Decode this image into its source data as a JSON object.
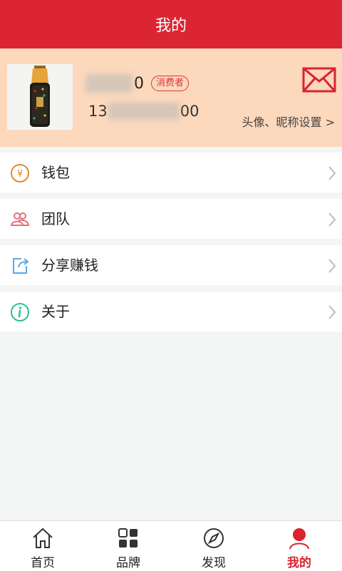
{
  "header": {
    "title": "我的"
  },
  "profile": {
    "avatar_icon": "product-bottle-avatar",
    "name_suffix": "0",
    "role_badge": "消费者",
    "phone_prefix": "13",
    "phone_suffix": "00",
    "settings_label": "头像、昵称设置 >"
  },
  "menu": [
    {
      "label": "钱包",
      "icon": "yuan-coin-icon"
    },
    {
      "label": "团队",
      "icon": "team-users-icon"
    },
    {
      "label": "分享赚钱",
      "icon": "share-icon"
    },
    {
      "label": "关于",
      "icon": "info-icon"
    }
  ],
  "tabbar": {
    "items": [
      {
        "label": "首页",
        "icon": "home-icon"
      },
      {
        "label": "品牌",
        "icon": "grid-icon"
      },
      {
        "label": "发现",
        "icon": "compass-icon"
      },
      {
        "label": "我的",
        "icon": "user-icon"
      }
    ],
    "active_index": 3,
    "active_color": "#d9232f"
  },
  "colors": {
    "accent": "#db2532",
    "profile_bg": "#fcd8bc",
    "page_bg": "#f4f5f5"
  }
}
